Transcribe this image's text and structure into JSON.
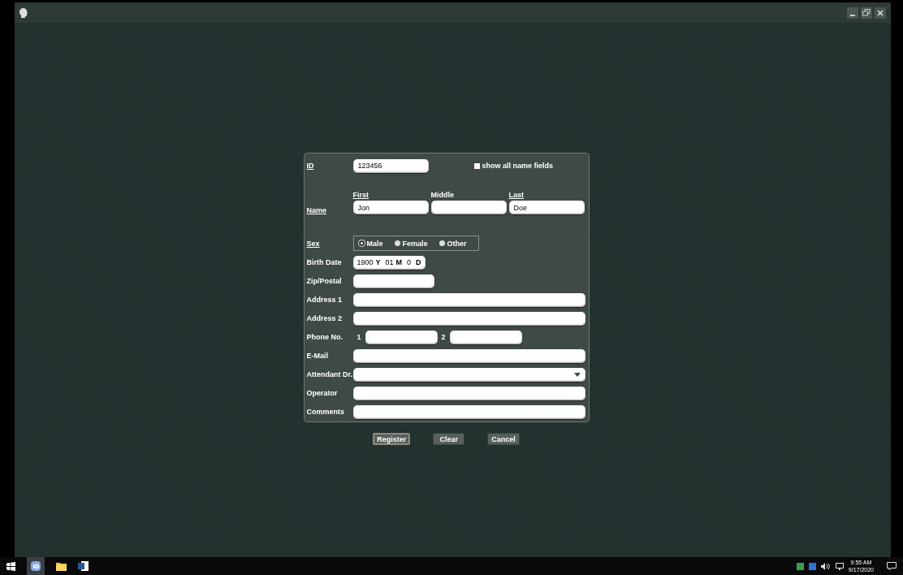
{
  "form": {
    "rows": [
      {
        "kind": "id",
        "label": "ID",
        "underlined": true,
        "value": "123456",
        "checkbox": {
          "label": "show all name fields",
          "checked": false
        }
      },
      {
        "kind": "name",
        "label": "Name",
        "underlined": true,
        "fields": [
          {
            "label": "First",
            "underlined": true,
            "value": "Jon"
          },
          {
            "label": "Middle",
            "underlined": false
          },
          {
            "label": "Last",
            "underlined": true,
            "value": "Doe"
          }
        ]
      },
      {
        "kind": "sex",
        "label": "Sex",
        "underlined": true,
        "options": [
          {
            "label": "Male",
            "selected": true
          },
          {
            "label": "Female",
            "selected": false
          },
          {
            "label": "Other",
            "selected": false
          }
        ]
      },
      {
        "kind": "date",
        "label": "Birth Date",
        "underlined": false,
        "parts": [
          {
            "value": "1900",
            "unit": "Y"
          },
          {
            "value": "01",
            "unit": "M"
          },
          {
            "value": "0",
            "unit": "D"
          }
        ]
      },
      {
        "kind": "short",
        "label": "Zip/Postal",
        "underlined": false
      },
      {
        "kind": "text",
        "label": "Address 1",
        "underlined": false
      },
      {
        "kind": "text",
        "label": "Address 2",
        "underlined": false
      },
      {
        "kind": "phone",
        "label": "Phone No.",
        "underlined": false,
        "fields": [
          {
            "label": "1"
          },
          {
            "label": "2"
          }
        ]
      },
      {
        "kind": "text",
        "label": "E-Mail",
        "underlined": false
      },
      {
        "kind": "dropdown",
        "label": "Attendant Dr.",
        "underlined": false
      },
      {
        "kind": "text",
        "label": "Operator",
        "underlined": false
      },
      {
        "kind": "text",
        "label": "Comments",
        "underlined": false
      }
    ]
  },
  "buttons": [
    {
      "label": "Register",
      "focused": true
    },
    {
      "label": "Clear",
      "focused": false
    },
    {
      "label": "Cancel",
      "focused": false
    }
  ],
  "taskbar": {
    "clock": {
      "time": "9:55 AM",
      "date": "9/17/2020"
    }
  }
}
